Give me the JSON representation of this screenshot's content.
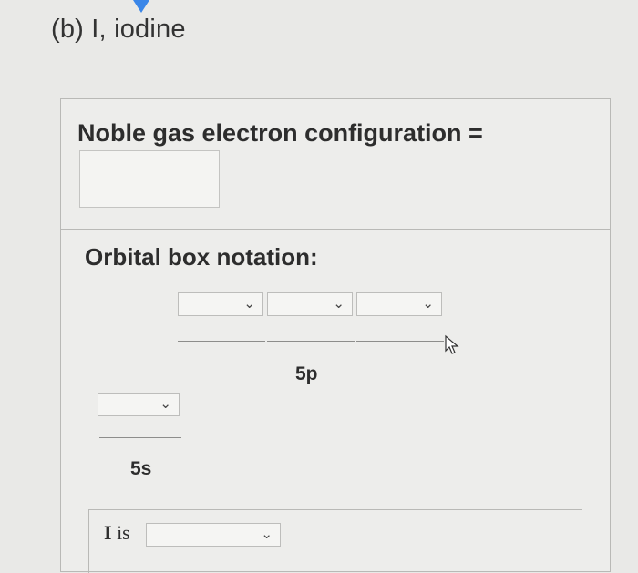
{
  "part_label": "(b)  I, iodine",
  "noble_gas": {
    "label": "Noble gas electron configuration  =",
    "answer": ""
  },
  "orbital": {
    "label": "Orbital box notation:",
    "p_orbital": {
      "name": "5p",
      "selects": [
        "",
        "",
        ""
      ]
    },
    "s_orbital": {
      "name": "5s",
      "selects": [
        ""
      ]
    }
  },
  "element_is": {
    "symbol": "I",
    "is_text": "is",
    "select_value": ""
  },
  "icons": {
    "dropdown": "chevron-down-icon",
    "cursor": "pointer-cursor-icon"
  },
  "colors": {
    "marker": "#3a86e8"
  }
}
